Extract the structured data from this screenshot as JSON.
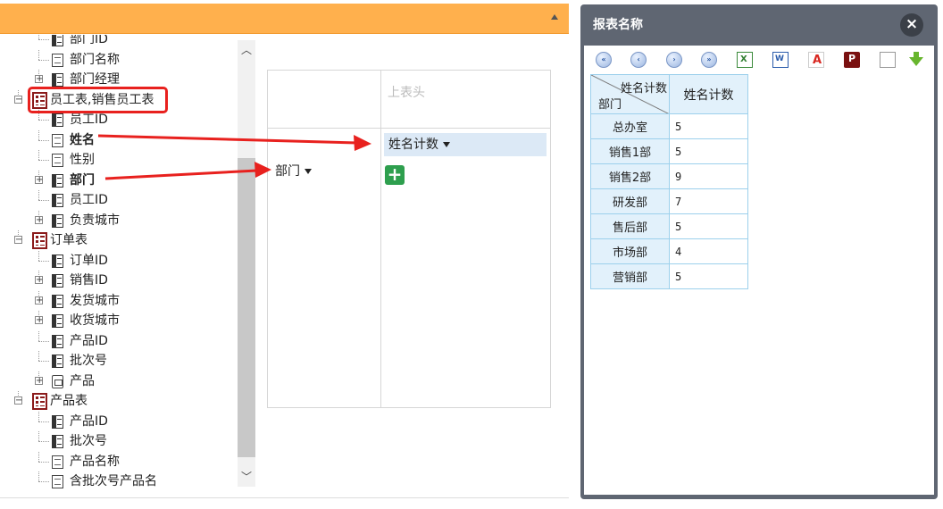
{
  "left_panel": {
    "header_title": ""
  },
  "tree": {
    "items": [
      {
        "label": "部门ID",
        "type": "dim",
        "expander": false,
        "bold": false
      },
      {
        "label": "部门名称",
        "type": "field",
        "expander": false,
        "bold": false
      },
      {
        "label": "部门经理",
        "type": "dim",
        "expander": true,
        "bold": false
      },
      {
        "label": "员工表,销售员工表",
        "type": "table",
        "expander": true,
        "bold": false
      },
      {
        "label": "员工ID",
        "type": "dim",
        "expander": false,
        "bold": false
      },
      {
        "label": "姓名",
        "type": "field",
        "expander": false,
        "bold": true
      },
      {
        "label": "性别",
        "type": "field",
        "expander": false,
        "bold": false
      },
      {
        "label": "部门",
        "type": "dim",
        "expander": true,
        "bold": true
      },
      {
        "label": "员工ID",
        "type": "dim",
        "expander": false,
        "bold": false
      },
      {
        "label": "负责城市",
        "type": "dim",
        "expander": true,
        "bold": false
      },
      {
        "label": "订单表",
        "type": "table",
        "expander": true,
        "bold": false
      },
      {
        "label": "订单ID",
        "type": "dim",
        "expander": false,
        "bold": false
      },
      {
        "label": "销售ID",
        "type": "dim",
        "expander": true,
        "bold": false
      },
      {
        "label": "发货城市",
        "type": "dim",
        "expander": true,
        "bold": false
      },
      {
        "label": "收货城市",
        "type": "dim",
        "expander": true,
        "bold": false
      },
      {
        "label": "产品ID",
        "type": "dim",
        "expander": false,
        "bold": false
      },
      {
        "label": "批次号",
        "type": "dim",
        "expander": false,
        "bold": false
      },
      {
        "label": "产品",
        "type": "folder",
        "expander": true,
        "bold": false
      },
      {
        "label": "产品表",
        "type": "table",
        "expander": true,
        "bold": false
      },
      {
        "label": "产品ID",
        "type": "dim",
        "expander": false,
        "bold": false
      },
      {
        "label": "批次号",
        "type": "dim",
        "expander": false,
        "bold": false
      },
      {
        "label": "产品名称",
        "type": "field",
        "expander": false,
        "bold": false
      },
      {
        "label": "含批次号产品名",
        "type": "field",
        "expander": false,
        "bold": false
      }
    ]
  },
  "pivot": {
    "top_header_placeholder": "上表头",
    "measure_chip": "姓名计数",
    "row_dimension_chip": "部门",
    "add_symbol": "+"
  },
  "report": {
    "title": "报表名称",
    "close_symbol": "×",
    "toolbar": [
      "first-page-icon",
      "prev-page-icon",
      "next-page-icon",
      "last-page-icon",
      "excel-export-icon",
      "word-export-icon",
      "pdf-export-icon",
      "print-icon",
      "text-export-icon",
      "download-icon"
    ],
    "corner_top": "姓名计数",
    "corner_bottom": "部门",
    "measure_header": "姓名计数",
    "rows": [
      {
        "dept": "总办室",
        "count": "5"
      },
      {
        "dept": "销售1部",
        "count": "5"
      },
      {
        "dept": "销售2部",
        "count": "9"
      },
      {
        "dept": "研发部",
        "count": "7"
      },
      {
        "dept": "售后部",
        "count": "5"
      },
      {
        "dept": "市场部",
        "count": "4"
      },
      {
        "dept": "营销部",
        "count": "5"
      }
    ]
  },
  "colors": {
    "header_orange": "#ffb04d",
    "highlight_red": "#e8211e",
    "chip_blue": "#dce9f6",
    "add_green": "#2e9f4e",
    "report_frame": "#5f6672",
    "table_border": "#9cd0ec"
  }
}
